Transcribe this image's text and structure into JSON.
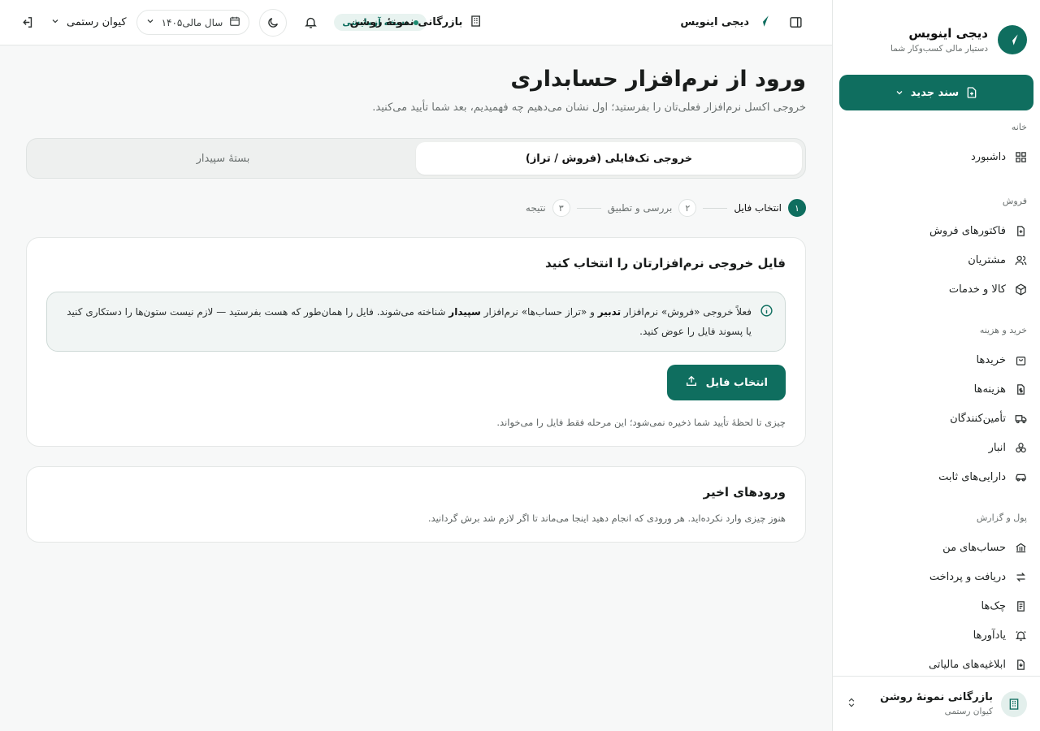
{
  "brand": {
    "name": "دیجی اینویس",
    "subtitle": "دستیار مالی کسب‌وکار شما"
  },
  "sidebar": {
    "new_doc_label": "سند جدید",
    "groups": [
      {
        "title": "خانه",
        "items": [
          {
            "label": "داشبورد",
            "icon": "grid-icon"
          }
        ]
      },
      {
        "title": "فروش",
        "items": [
          {
            "label": "فاکتورهای فروش",
            "icon": "invoice-icon"
          },
          {
            "label": "مشتریان",
            "icon": "users-icon"
          },
          {
            "label": "کالا و خدمات",
            "icon": "box-icon"
          }
        ]
      },
      {
        "title": "خرید و هزینه",
        "items": [
          {
            "label": "خریدها",
            "icon": "bag-icon"
          },
          {
            "label": "هزینه‌ها",
            "icon": "dollar-doc-icon"
          },
          {
            "label": "تأمین‌کنندگان",
            "icon": "truck-icon"
          },
          {
            "label": "انبار",
            "icon": "boxes-icon"
          },
          {
            "label": "دارایی‌های ثابت",
            "icon": "car-icon"
          }
        ]
      },
      {
        "title": "پول و گزارش",
        "items": [
          {
            "label": "حساب‌های من",
            "icon": "bank-icon"
          },
          {
            "label": "دریافت و پرداخت",
            "icon": "arrows-icon"
          },
          {
            "label": "چک‌ها",
            "icon": "cheque-icon"
          },
          {
            "label": "یادآورها",
            "icon": "bell-ring-icon"
          },
          {
            "label": "ابلاغیه‌های مالیاتی",
            "icon": "tax-doc-icon"
          }
        ]
      }
    ],
    "org": {
      "name": "بازرگانی نمونهٔ روشن",
      "user": "کیوان رستمی"
    }
  },
  "topbar": {
    "app_name": "دیجی اینویس",
    "org_name": "بازرگانی نمونهٔ روشن",
    "trial_badge": "نسخه آزمایشی",
    "year_label": "سال مالی۱۴۰۵",
    "user_name": "کیوان رستمی"
  },
  "page": {
    "title": "ورود از نرم‌افزار حسابداری",
    "subtitle": "خروجی اکسل نرم‌افزار فعلی‌تان را بفرستید؛ اول نشان می‌دهیم چه فهمیدیم، بعد شما تأیید می‌کنید.",
    "tabs": [
      {
        "label": "خروجی تک‌فایلی (فروش / تراز)",
        "active": true
      },
      {
        "label": "بستهٔ سپیدار",
        "active": false
      }
    ],
    "steps": [
      {
        "num": "۱",
        "label": "انتخاب فایل"
      },
      {
        "num": "۲",
        "label": "بررسی و تطبیق"
      },
      {
        "num": "۳",
        "label": "نتیجه"
      }
    ]
  },
  "upload_card": {
    "title": "فایل خروجی نرم‌افزارتان را انتخاب کنید",
    "info": {
      "p1": "فعلاً خروجی «فروش» نرم‌افزار ",
      "b1": "تدبیر",
      "p2": " و «تراز حساب‌ها» نرم‌افزار ",
      "b2": "سپیدار",
      "p3": " شناخته می‌شوند. فایل را همان‌طور که هست بفرستید — لازم نیست ستون‌ها را دستکاری کنید یا پسوند فایل را عوض کنید."
    },
    "button": "انتخاب فایل",
    "hint": "چیزی تا لحظهٔ تأیید شما ذخیره نمی‌شود؛ این مرحله فقط فایل را می‌خواند."
  },
  "recent_card": {
    "title": "ورودهای اخیر",
    "desc": "هنوز چیزی وارد نکرده‌اید. هر ورودی که انجام دهید اینجا می‌ماند تا اگر لازم شد برش گردانید."
  },
  "colors": {
    "brand": "#0f6e5f",
    "trial_bg": "#e8f3f0"
  }
}
